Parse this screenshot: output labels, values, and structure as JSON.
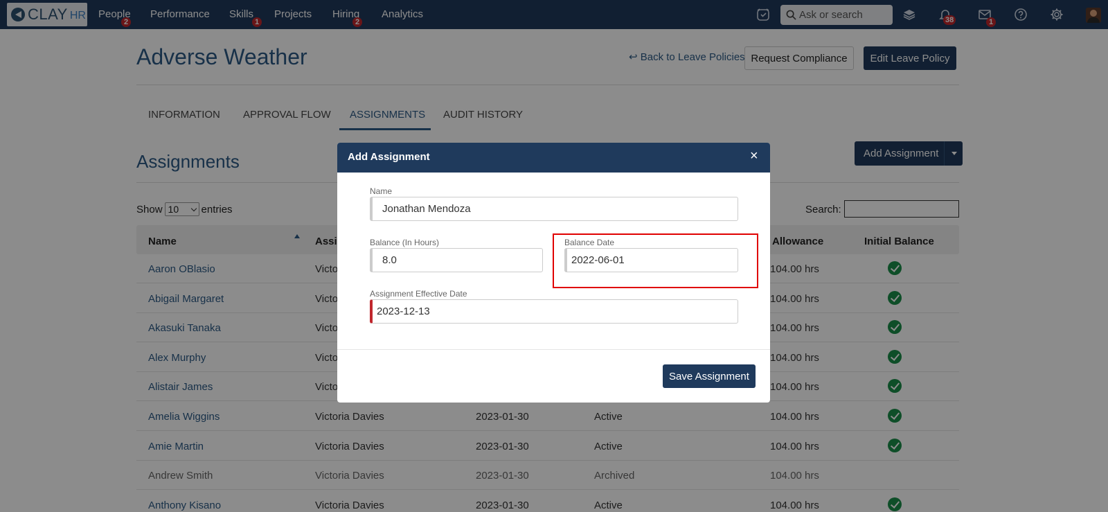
{
  "nav": {
    "logo_text": "CLAY",
    "logo_sub": "HR",
    "items": [
      {
        "label": "People",
        "badge": "2"
      },
      {
        "label": "Performance",
        "badge": ""
      },
      {
        "label": "Skills",
        "badge": "1"
      },
      {
        "label": "Projects",
        "badge": ""
      },
      {
        "label": "Hiring",
        "badge": "2"
      },
      {
        "label": "Analytics",
        "badge": ""
      }
    ],
    "search_placeholder": "Ask or search",
    "notifications_badge": "38",
    "mail_badge": "1",
    "icons": [
      "time-clock-icon",
      "search-icon",
      "layers-icon",
      "bell-icon",
      "mail-icon",
      "help-icon",
      "gear-icon"
    ]
  },
  "page": {
    "title": "Adverse Weather",
    "back_link": "Back to Leave Policies",
    "request_compliance": "Request Compliance",
    "edit_policy": "Edit Leave Policy"
  },
  "tabs": [
    "INFORMATION",
    "APPROVAL FLOW",
    "ASSIGNMENTS",
    "AUDIT HISTORY"
  ],
  "active_tab": "ASSIGNMENTS",
  "assignments": {
    "title": "Assignments",
    "add_button": "Add Assignment",
    "show_label": "Show",
    "entries_value": "10",
    "entries_label": "entries",
    "search_label": "Search:",
    "columns": [
      "Name",
      "Assig",
      "Allowance",
      "Initial Balance"
    ],
    "rows": [
      {
        "name": "Aaron OBlasio",
        "assigned_by": "Victo",
        "date": "",
        "status": "",
        "allowance": "104.00 hrs",
        "initial": true,
        "archived": false
      },
      {
        "name": "Abigail Margaret",
        "assigned_by": "Victo",
        "date": "",
        "status": "",
        "allowance": "104.00 hrs",
        "initial": true,
        "archived": false
      },
      {
        "name": "Akasuki Tanaka",
        "assigned_by": "Victo",
        "date": "",
        "status": "",
        "allowance": "104.00 hrs",
        "initial": true,
        "archived": false
      },
      {
        "name": "Alex Murphy",
        "assigned_by": "Victo",
        "date": "",
        "status": "",
        "allowance": "104.00 hrs",
        "initial": true,
        "archived": false
      },
      {
        "name": "Alistair James",
        "assigned_by": "Victo",
        "date": "",
        "status": "",
        "allowance": "104.00 hrs",
        "initial": true,
        "archived": false
      },
      {
        "name": "Amelia Wiggins",
        "assigned_by": "Victoria Davies",
        "date": "2023-01-30",
        "status": "Active",
        "allowance": "104.00 hrs",
        "initial": true,
        "archived": false
      },
      {
        "name": "Amie Martin",
        "assigned_by": "Victoria Davies",
        "date": "2023-01-30",
        "status": "Active",
        "allowance": "104.00 hrs",
        "initial": true,
        "archived": false
      },
      {
        "name": "Andrew Smith",
        "assigned_by": "Victoria Davies",
        "date": "2023-01-30",
        "status": "Archived",
        "allowance": "104.00 hrs",
        "initial": false,
        "archived": true
      },
      {
        "name": "Anthony Kisano",
        "assigned_by": "Victoria Davies",
        "date": "2023-01-30",
        "status": "Active",
        "allowance": "104.00 hrs",
        "initial": true,
        "archived": false
      }
    ]
  },
  "modal": {
    "title": "Add Assignment",
    "close": "×",
    "name_label": "Name",
    "name_value": "Jonathan Mendoza",
    "balance_label": "Balance (In Hours)",
    "balance_value": "8.0",
    "balance_date_label": "Balance Date",
    "balance_date_value": "2022-06-01",
    "effective_label": "Assignment Effective Date",
    "effective_value": "2023-12-13",
    "save_button": "Save Assignment"
  },
  "colors": {
    "navy": "#1f3a5c",
    "link": "#2c5a85",
    "badge": "#c0272d",
    "check": "#1a8f4a",
    "highlight": "#e00000"
  }
}
